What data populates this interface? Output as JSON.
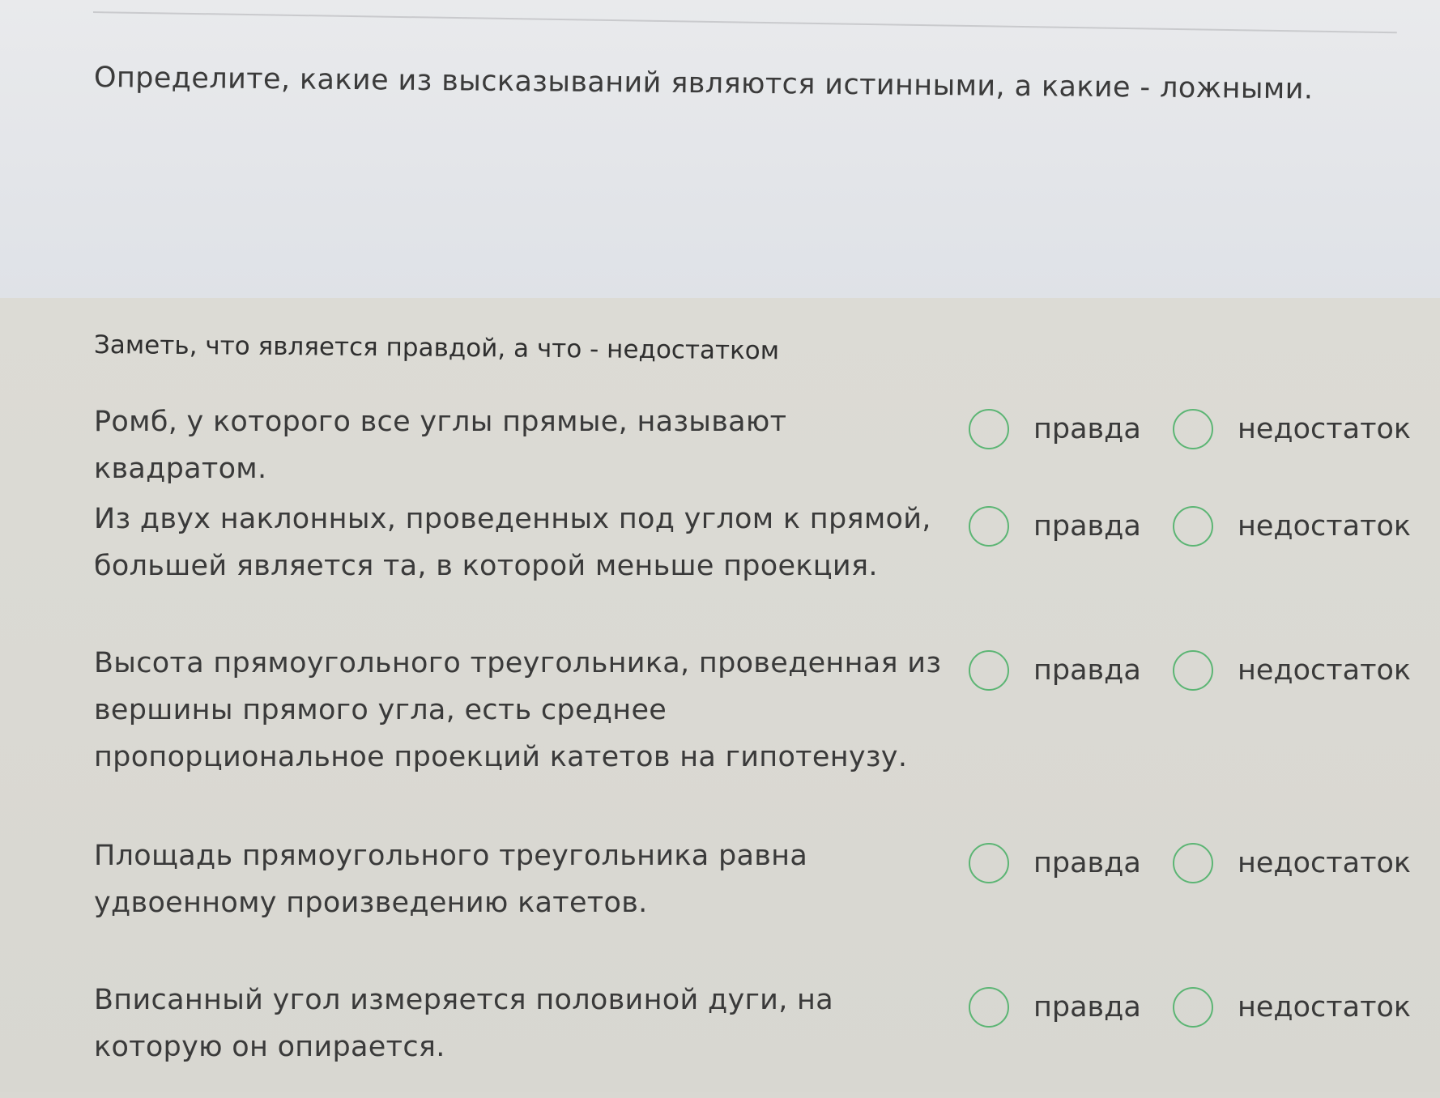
{
  "question": {
    "text": "Определите, какие из высказываний являются истинными, а какие - ложными."
  },
  "instruction": {
    "text": "Заметь, что является правдой, а что - недостатком"
  },
  "options": {
    "true_label": "правда",
    "false_label": "недостаток"
  },
  "statements": [
    {
      "text": "Ромб, у которого все углы прямые, называют квадратом."
    },
    {
      "text": "Из двух наклонных, проведенных под углом к прямой, большей является та, в которой меньше проекция."
    },
    {
      "text": "Высота прямоугольного треугольника, проведенная из вершины прямого угла, есть среднее пропорциональное проекций катетов на гипотенузу."
    },
    {
      "text": "Площадь прямоугольного треугольника равна удвоенному произведению катетов."
    },
    {
      "text": "Вписанный угол измеряется половиной дуги, на которую он опирается."
    }
  ],
  "colors": {
    "radio_border": "#5cb574",
    "top_background": "#e5e7ea",
    "bottom_background": "#d9d8d2"
  }
}
